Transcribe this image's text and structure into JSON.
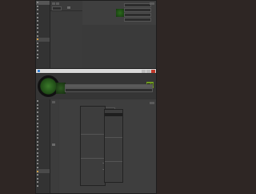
{
  "top_window": {
    "title": "",
    "sidebar_items": [
      "",
      "",
      "",
      "",
      "",
      "",
      "",
      "",
      "",
      "",
      "",
      "",
      "",
      "",
      ""
    ],
    "highlighted_index": 9,
    "fields": [
      "",
      "",
      "",
      "",
      ""
    ]
  },
  "bottom_window": {
    "title": "",
    "badge": "ms",
    "sidebar_items": [
      "",
      "",
      "",
      "",
      "",
      "",
      "",
      "",
      "",
      "",
      "",
      "",
      "",
      "",
      "",
      "",
      "",
      "",
      "",
      "",
      "",
      "",
      "",
      ""
    ],
    "highlighted_index": 19,
    "props": [
      "",
      "",
      "",
      "",
      "",
      "",
      ""
    ],
    "menu_items": [
      "",
      "",
      "",
      "",
      "",
      "",
      "",
      "",
      "",
      "",
      "",
      "",
      "",
      "",
      "",
      "",
      "",
      "",
      "",
      "",
      "",
      "",
      ""
    ],
    "submenu_items": [
      "",
      "",
      "",
      "",
      "",
      "",
      "",
      "",
      "",
      "",
      "",
      "",
      "",
      "",
      "",
      "",
      "",
      "",
      "",
      "",
      ""
    ],
    "submenu_selected": 1
  }
}
